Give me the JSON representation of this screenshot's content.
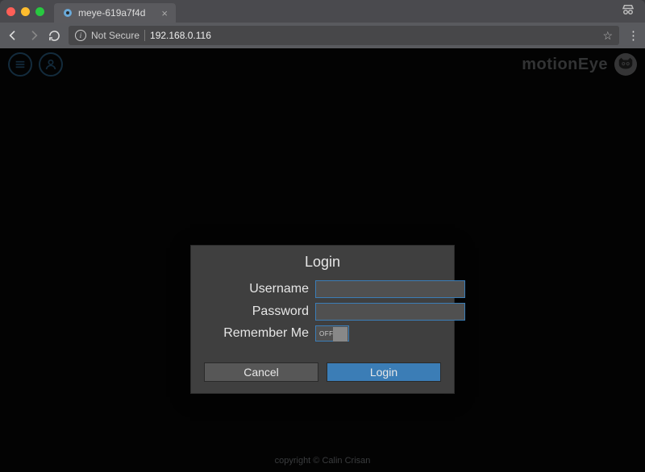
{
  "browser": {
    "tab_title": "meye-619a7f4d",
    "not_secure_label": "Not Secure",
    "url": "192.168.0.116"
  },
  "header": {
    "brand": "motionEye"
  },
  "dialog": {
    "title": "Login",
    "labels": {
      "username": "Username",
      "password": "Password",
      "remember": "Remember Me"
    },
    "values": {
      "username": "",
      "password": ""
    },
    "switch": {
      "off_label": "OFF",
      "state": "off"
    },
    "buttons": {
      "cancel": "Cancel",
      "login": "Login"
    }
  },
  "footer": {
    "copyright": "copyright © Calin Crisan"
  }
}
